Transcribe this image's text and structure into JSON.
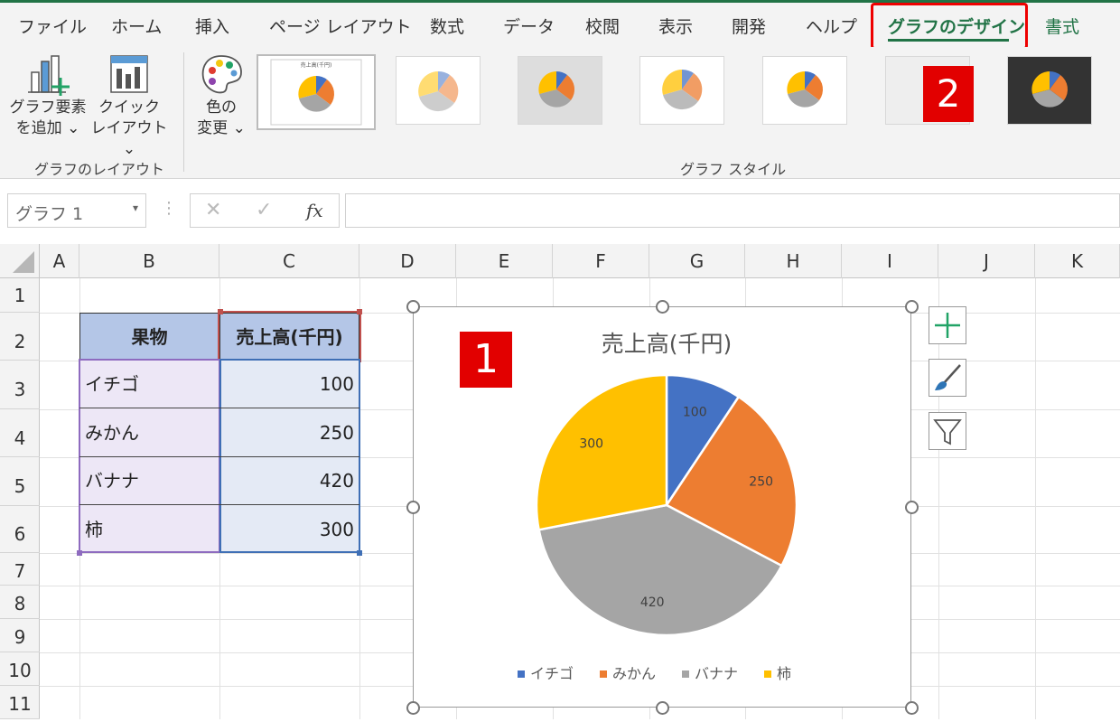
{
  "tabs": [
    "ファイル",
    "ホーム",
    "挿入",
    "ページ レイアウト",
    "数式",
    "データ",
    "校閲",
    "表示",
    "開発",
    "ヘルプ",
    "グラフのデザイン",
    "書式"
  ],
  "ribbon": {
    "add_element": [
      "グラフ要素",
      "を追加 ⌄"
    ],
    "quick_layout": [
      "クイック",
      "レイアウト ⌄"
    ],
    "colors": [
      "色の",
      "変更 ⌄"
    ],
    "group_layout": "グラフのレイアウト",
    "group_styles": "グラフ スタイル",
    "thumb_title": "売上高(千円)"
  },
  "markers": {
    "one": "1",
    "two": "2"
  },
  "formula_bar": {
    "name_box": "グラフ 1",
    "cancel": "✕",
    "enter": "✓",
    "fx": "fx"
  },
  "columns": [
    "A",
    "B",
    "C",
    "D",
    "E",
    "F",
    "G",
    "H",
    "I",
    "J",
    "K"
  ],
  "rows": [
    "1",
    "2",
    "3",
    "4",
    "5",
    "6",
    "7",
    "8",
    "9",
    "10",
    "11"
  ],
  "table": {
    "headers": [
      "果物",
      "売上高(千円)"
    ],
    "rows": [
      [
        "イチゴ",
        "100"
      ],
      [
        "みかん",
        "250"
      ],
      [
        "バナナ",
        "420"
      ],
      [
        "柿",
        "300"
      ]
    ]
  },
  "colors": {
    "blue": "#4472c4",
    "orange": "#ed7d31",
    "gray": "#a5a5a5",
    "gold": "#ffc000",
    "excel_green": "#217346",
    "highlight_red": "#e00000"
  },
  "chart_data": {
    "type": "pie",
    "title": "売上高(千円)",
    "categories": [
      "イチゴ",
      "みかん",
      "バナナ",
      "柿"
    ],
    "values": [
      100,
      250,
      420,
      300
    ],
    "colors": [
      "#4472c4",
      "#ed7d31",
      "#a5a5a5",
      "#ffc000"
    ],
    "data_labels": [
      "100",
      "250",
      "420",
      "300"
    ],
    "legend_position": "bottom"
  },
  "chart_side_buttons": [
    "plus-icon",
    "brush-icon",
    "filter-icon"
  ]
}
